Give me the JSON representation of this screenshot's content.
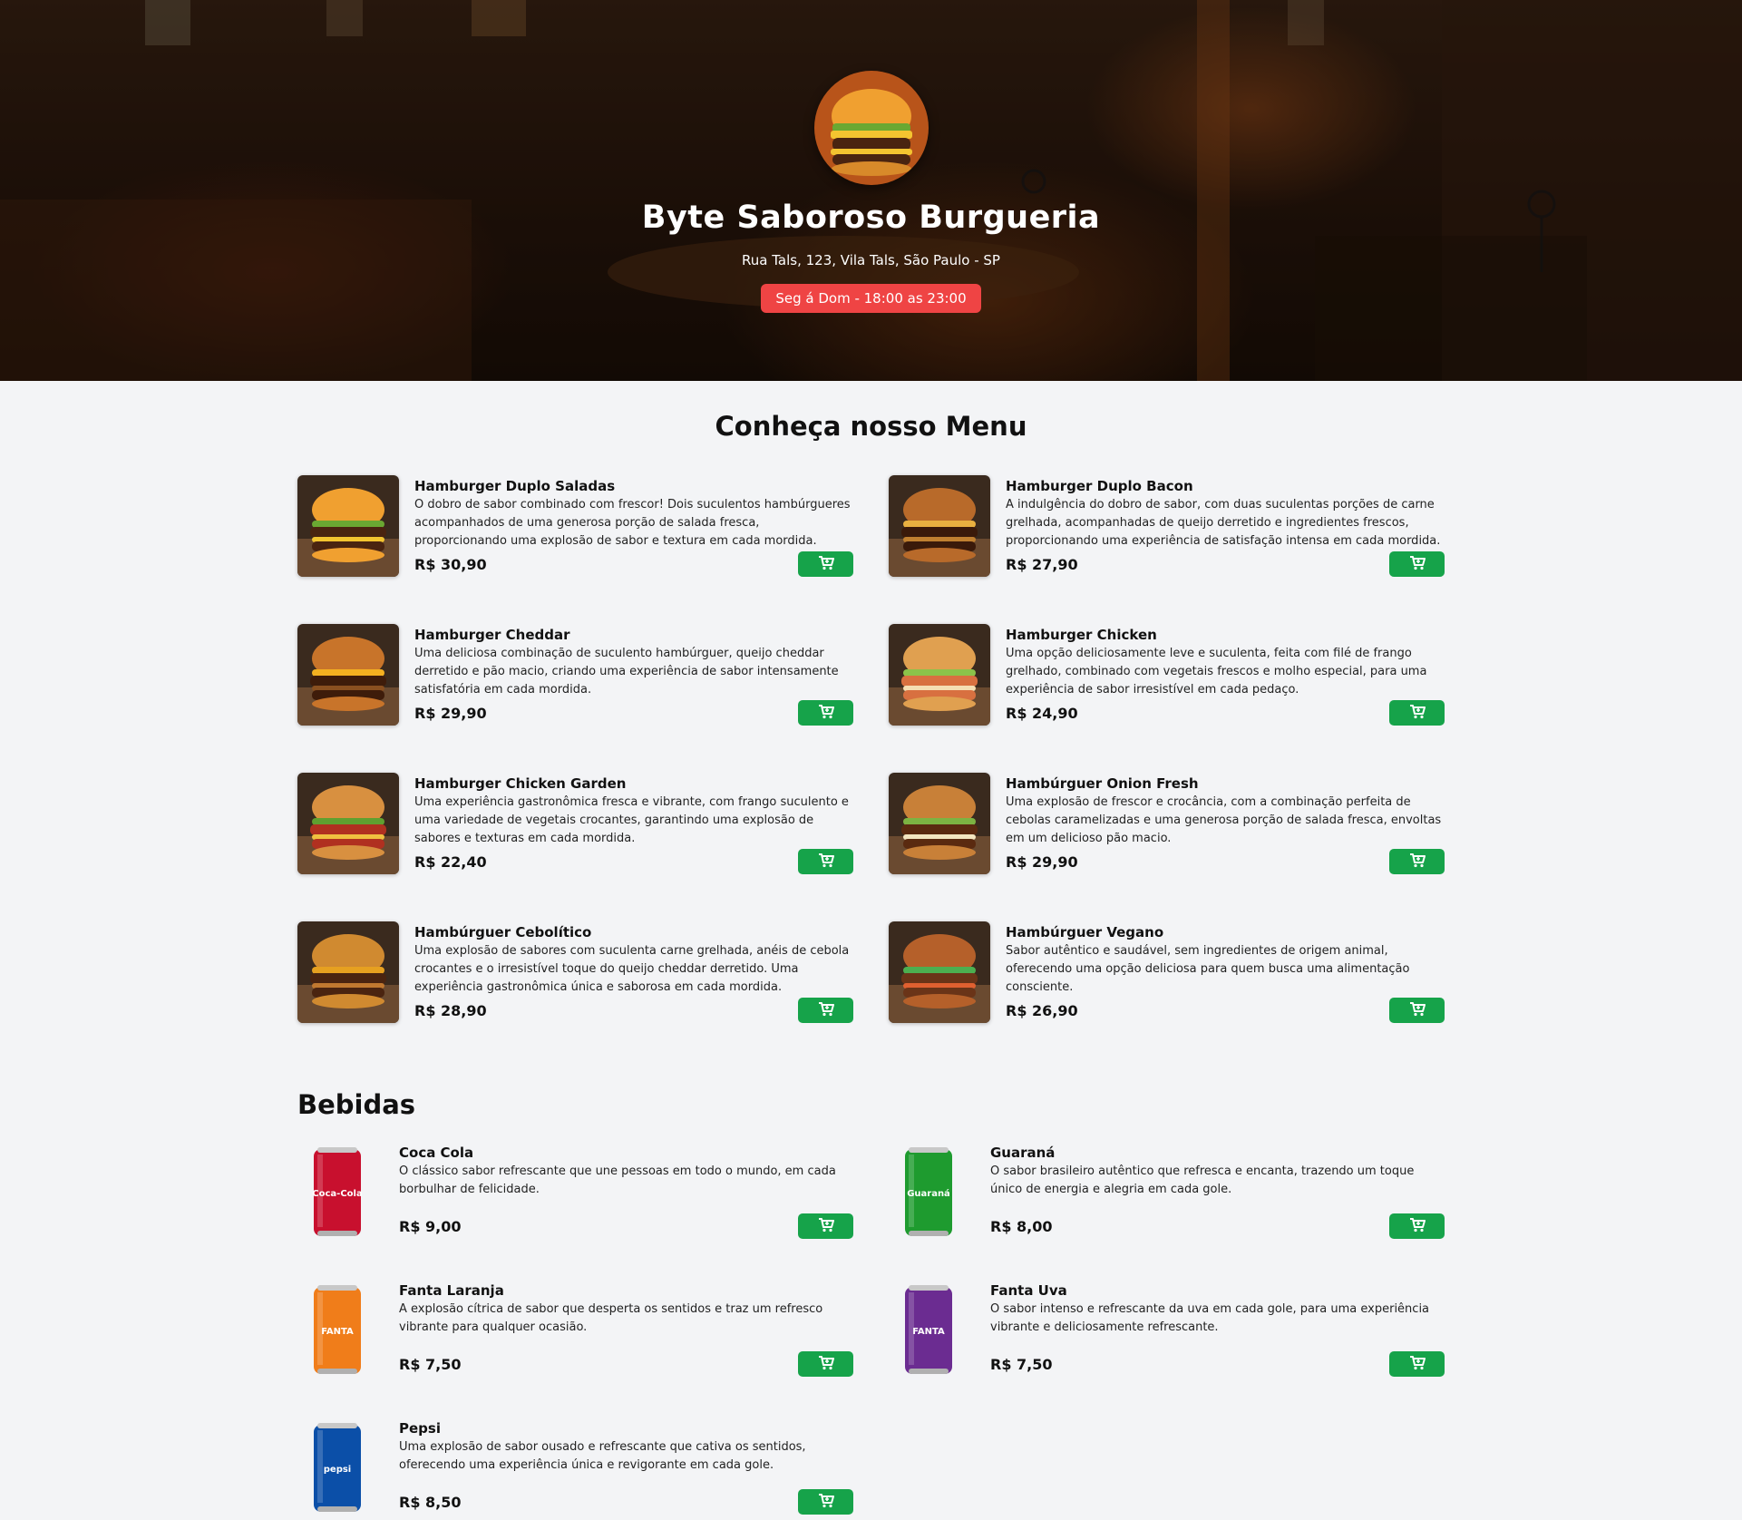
{
  "header": {
    "title": "Byte Saboroso Burgueria",
    "address": "Rua Tals, 123, Vila Tals, São Paulo - SP",
    "hours": "Seg á Dom - 18:00 as 23:00"
  },
  "menu": {
    "title": "Conheça nosso Menu",
    "items": [
      {
        "name": "Hamburger Duplo Saladas",
        "desc": "O dobro de sabor combinado com frescor! Dois suculentos hambúrgueres acompanhados de uma generosa porção de salada fresca, proporcionando uma explosão de sabor e textura em cada mordida.",
        "price": "R$ 30,90"
      },
      {
        "name": "Hamburger Duplo Bacon",
        "desc": "A indulgência do dobro de sabor, com duas suculentas porções de carne grelhada, acompanhadas de queijo derretido e ingredientes frescos, proporcionando uma experiência de satisfação intensa em cada mordida.",
        "price": "R$ 27,90"
      },
      {
        "name": "Hamburger Cheddar",
        "desc": "Uma deliciosa combinação de suculento hambúrguer, queijo cheddar derretido e pão macio, criando uma experiência de sabor intensamente satisfatória em cada mordida.",
        "price": "R$ 29,90"
      },
      {
        "name": "Hamburger Chicken",
        "desc": "Uma opção deliciosamente leve e suculenta, feita com filé de frango grelhado, combinado com vegetais frescos e molho especial, para uma experiência de sabor irresistível em cada pedaço.",
        "price": "R$ 24,90"
      },
      {
        "name": "Hamburger Chicken Garden",
        "desc": "Uma experiência gastronômica fresca e vibrante, com frango suculento e uma variedade de vegetais crocantes, garantindo uma explosão de sabores e texturas em cada mordida.",
        "price": "R$ 22,40"
      },
      {
        "name": "Hambúrguer Onion Fresh",
        "desc": "Uma explosão de frescor e crocância, com a combinação perfeita de cebolas caramelizadas e uma generosa porção de salada fresca, envoltas em um delicioso pão macio.",
        "price": "R$ 29,90"
      },
      {
        "name": "Hambúrguer Cebolítico",
        "desc": "Uma explosão de sabores com suculenta carne grelhada, anéis de cebola crocantes e o irresistível toque do queijo cheddar derretido. Uma experiência gastronômica única e saborosa em cada mordida.",
        "price": "R$ 28,90"
      },
      {
        "name": "Hambúrguer Vegano",
        "desc": "Sabor autêntico e saudável, sem ingredientes de origem animal, oferecendo uma opção deliciosa para quem busca uma alimentação consciente.",
        "price": "R$ 26,90"
      }
    ]
  },
  "drinks": {
    "title": "Bebidas",
    "items": [
      {
        "name": "Coca Cola",
        "desc": "O clássico sabor refrescante que une pessoas em todo o mundo, em cada borbulhar de felicidade.",
        "price": "R$ 9,00",
        "color": "#c8102e",
        "can_text": "Coca-Cola"
      },
      {
        "name": "Guaraná",
        "desc": "O sabor brasileiro autêntico que refresca e encanta, trazendo um toque único de energia e alegria em cada gole.",
        "price": "R$ 8,00",
        "color": "#1e9b2f",
        "can_text": "Guaraná"
      },
      {
        "name": "Fanta Laranja",
        "desc": "A explosão cítrica de sabor que desperta os sentidos e traz um refresco vibrante para qualquer ocasião.",
        "price": "R$ 7,50",
        "color": "#f07d1a",
        "can_text": "FANTA"
      },
      {
        "name": "Fanta Uva",
        "desc": "O sabor intenso e refrescante da uva em cada gole, para uma experiência vibrante e deliciosamente refrescante.",
        "price": "R$ 7,50",
        "color": "#6b2c91",
        "can_text": "FANTA"
      },
      {
        "name": "Pepsi",
        "desc": "Uma explosão de sabor ousado e refrescante que cativa os sentidos, oferecendo uma experiência única e revigorante em cada gole.",
        "price": "R$ 8,50",
        "color": "#0b4fa8",
        "can_text": "pepsi"
      }
    ]
  },
  "colors": {
    "accent": "#16a34a",
    "badge": "#ef4444"
  }
}
